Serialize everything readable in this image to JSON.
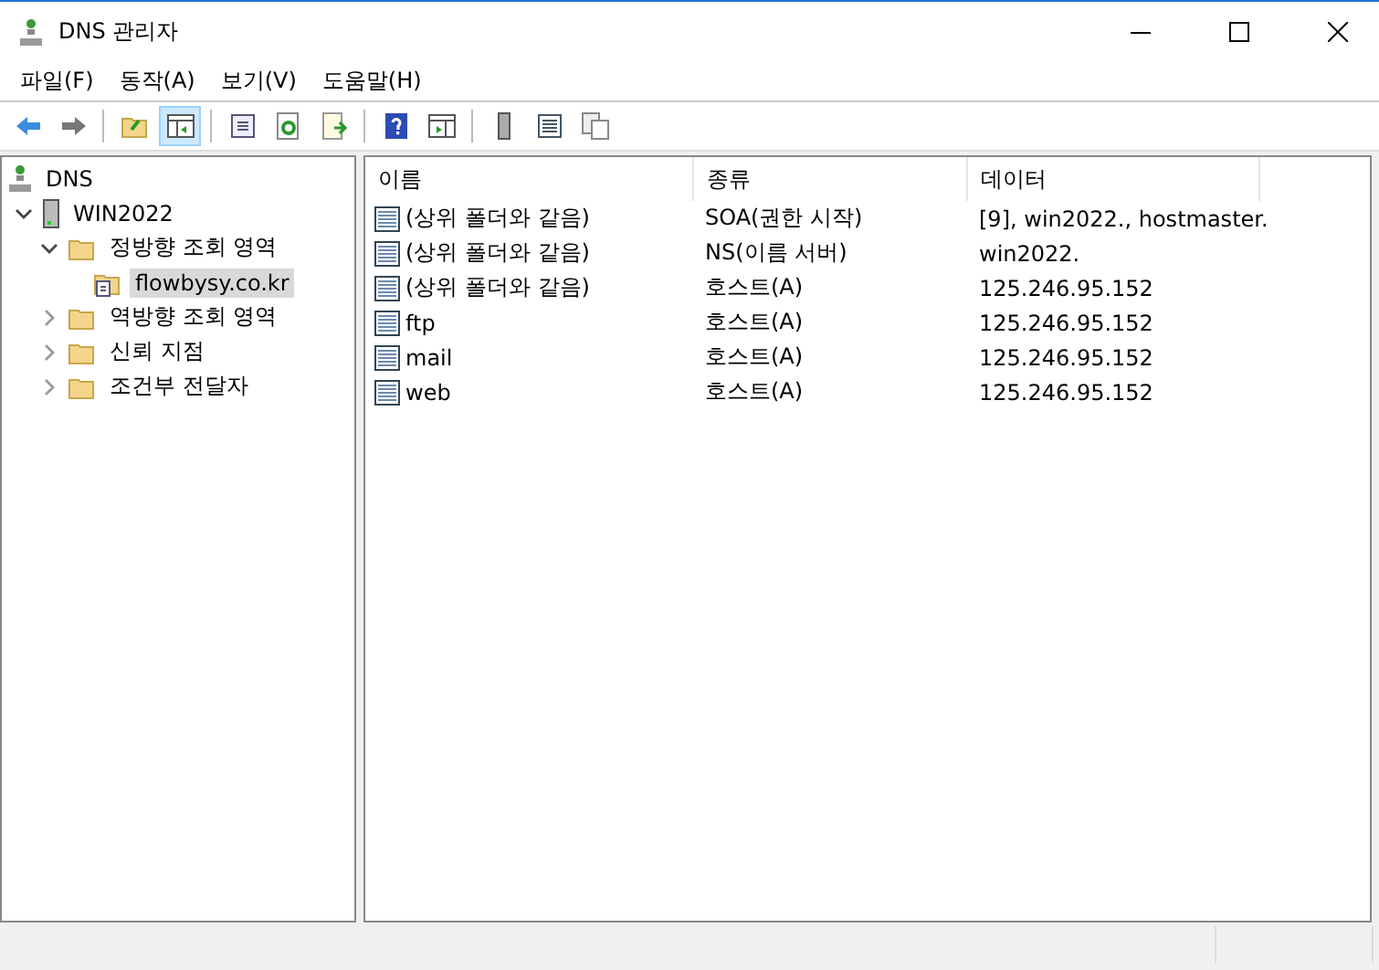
{
  "window": {
    "title": "DNS 관리자"
  },
  "menu": [
    "파일(F)",
    "동작(A)",
    "보기(V)",
    "도움말(H)"
  ],
  "toolbar": [
    [
      {
        "kind": "back",
        "selected": false
      },
      {
        "kind": "forward",
        "selected": false
      }
    ],
    [
      {
        "kind": "up",
        "selected": false
      },
      {
        "kind": "tree",
        "selected": true
      }
    ],
    [
      {
        "kind": "props",
        "selected": false
      },
      {
        "kind": "refresh",
        "selected": false
      },
      {
        "kind": "export",
        "selected": false
      }
    ],
    [
      {
        "kind": "help",
        "selected": false
      },
      {
        "kind": "pane",
        "selected": false
      }
    ],
    [
      {
        "kind": "server",
        "selected": false
      },
      {
        "kind": "list",
        "selected": false
      },
      {
        "kind": "copy",
        "selected": false
      }
    ]
  ],
  "tree": [
    {
      "label": "DNS",
      "kind": "dns",
      "selected": false,
      "children": [
        {
          "label": "WIN2022",
          "kind": "server",
          "expanded": true,
          "selected": false,
          "children": [
            {
              "label": "정방향 조회 영역",
              "kind": "folder",
              "expanded": true,
              "selected": false,
              "children": [
                {
                  "label": "flowbysy.co.kr",
                  "kind": "zone",
                  "selected": true
                }
              ]
            },
            {
              "label": "역방향 조회 영역",
              "kind": "folder",
              "expanded": false,
              "selected": false
            },
            {
              "label": "신뢰 지점",
              "kind": "folder",
              "expanded": false,
              "selected": false
            },
            {
              "label": "조건부 전달자",
              "kind": "folder",
              "expanded": false,
              "selected": false
            }
          ]
        }
      ]
    }
  ],
  "table": {
    "columns": [
      "이름",
      "종류",
      "데이터"
    ],
    "rows": [
      [
        "(상위 폴더와 같음)",
        "SOA(권한 시작)",
        "[9], win2022., hostmaster."
      ],
      [
        "(상위 폴더와 같음)",
        "NS(이름 서버)",
        "win2022."
      ],
      [
        "(상위 폴더와 같음)",
        "호스트(A)",
        "125.246.95.152"
      ],
      [
        "ftp",
        "호스트(A)",
        "125.246.95.152"
      ],
      [
        "mail",
        "호스트(A)",
        "125.246.95.152"
      ],
      [
        "web",
        "호스트(A)",
        "125.246.95.152"
      ]
    ]
  }
}
